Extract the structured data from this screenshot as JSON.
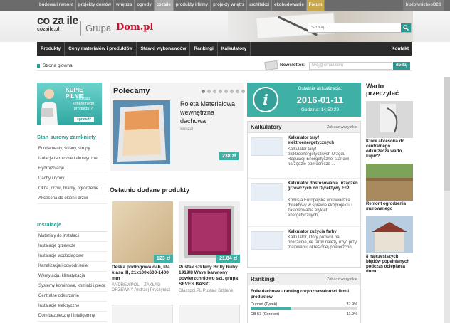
{
  "topbar": {
    "links": [
      "budowa i remont",
      "projekty domów",
      "wnętrza",
      "ogrody",
      "cozaile",
      "produkty i firmy",
      "projekty wnętrz",
      "architekci",
      "ekobudowanie",
      "Forum"
    ],
    "active_index": 4,
    "forum_index": 9,
    "b2b": "budownictwoB2B"
  },
  "header": {
    "logo": "co za ile",
    "logo_sub": "cozaile.pl",
    "grupa": "Grupa",
    "dom_logo": "Dom.pl",
    "search_placeholder": "Szukaj..."
  },
  "nav": {
    "items": [
      "Produkty",
      "Ceny materiałów i produktów",
      "Stawki wykonawców",
      "Rankingi",
      "Kalkulatory"
    ],
    "contact": "Kontakt"
  },
  "breadcrumb": "Strona główna",
  "newsletter": {
    "label": "Newsletter:",
    "placeholder": "twój@email.com",
    "button": "dodaj"
  },
  "promo": {
    "title": "KUPIĘ PILNIE",
    "text": "Szukasz konkretnego produktu ?",
    "button": "sprawdź"
  },
  "sidebar": {
    "sections": [
      {
        "title": "Stan surowy zamknięty",
        "items": [
          "Fundamenty, ściany, stropy",
          "Izolacje termiczne i akustyczne",
          "Hydroizolacje",
          "Dachy i rynny",
          "Okna, drzwi, bramy, ogrodzenie",
          "Akcesoria do okien i drzwi"
        ]
      },
      {
        "title": "Instalacje",
        "items": [
          "Materiały do instalacji",
          "Instalacje grzewcze",
          "Instalacje wodociągowe",
          "Kanalizacja i odwodnienie",
          "Wentylacja, klimatyzacja",
          "Systemy kominowe, kominki i piece",
          "Centralne odkurzanie",
          "Instalacje elektryczne",
          "Dom bezpieczny i inteligentny"
        ]
      }
    ]
  },
  "polecamy": {
    "heading": "Polecamy",
    "dots": 8,
    "active_dot": 0,
    "title": "Roleta Materiałowa wewnętrzna dachowa",
    "brand": "Sunzal",
    "price": "238 zł"
  },
  "ostatnio": {
    "heading": "Ostatnio dodane produkty",
    "products": [
      {
        "name": "Deska podłogowa dąb, lita klasa III, 21x100x600-1400 mm",
        "meta": "ANDREWPOL – ZAKŁAD DRZEWNY Andrzej Pryczynicz",
        "price": "123 zł"
      },
      {
        "name": "Pustak szklany Brilly Ruby 1919/8 Wave barwiony powierzchniowo szt. grupa SEVES BASIC",
        "meta": "Glasspol.PL Pustaki Szklane",
        "price": "21.84 zł"
      }
    ]
  },
  "update": {
    "label": "Ostatnia aktualizacja:",
    "date": "2016-01-11",
    "time": "Godzina: 14:50:29"
  },
  "kalkulatory": {
    "heading": "Kalkulatory",
    "see_all": "Zobacz wszystkie",
    "items": [
      {
        "title": "Kalkulator taryf elektroenergetycznych",
        "desc": "Kalkulator taryf elektroenergetycznych Urzędu Regulacji Energetycznej stanowi narzędzie pomocnicze ..."
      },
      {
        "title": "Kalkulator dostosowania urządzeń grzewczych do Dyrektywy ErP",
        "desc": "Komisja Europejska wprowadziła dyrektywy w sprawie ekoprojektu i zastosowania etykiet energetycznych, ..."
      },
      {
        "title": "Kalkulator zużycia farby",
        "desc": "Kalkulator, który pozwoli na obliczenie, ile farby należy użyć przy malowaniu określonej powierzchni."
      }
    ]
  },
  "rankingi": {
    "heading": "Rankingi",
    "see_all": "Zobacz wszystkie",
    "title": "Folie dachowe - ranking rozpoznawalności firm i produktów",
    "rows": [
      {
        "name": "Dupont (Tyvek)",
        "value": "37.9%",
        "fraction": 0.379
      },
      {
        "name": "CB 53 (Corotop)",
        "value": "11.9%",
        "fraction": 0.119
      }
    ]
  },
  "warto": {
    "heading": "Warto przeczytać",
    "articles": [
      "Które akcesoria do centralnego odkurzacza warto kupić?",
      "Remont ogrodzenia murowanego",
      "8 najczęstszych błędów popełnianych podczas ocieplania domu"
    ]
  },
  "colors": {
    "accent": "#3fb0a6",
    "nav_bg": "#2b2b2b",
    "topbar_bg": "#6b6b6b",
    "brand_red": "#c8102e"
  }
}
